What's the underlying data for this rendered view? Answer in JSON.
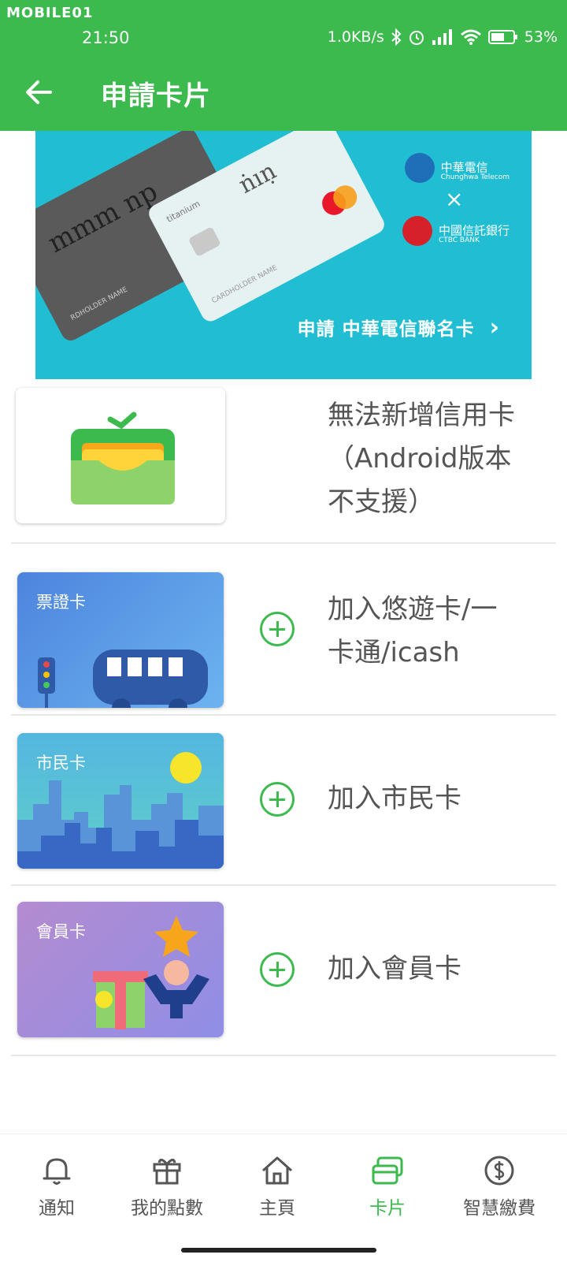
{
  "status_bar": {
    "watermark": "MOBILE01",
    "time": "21:50",
    "net_speed": "1.0KB/s",
    "battery": "53%"
  },
  "app_bar": {
    "title": "申請卡片"
  },
  "banner": {
    "card_dark_text": "mmm np",
    "card_dark_name": "RDHOLDER NAME",
    "card_light_text": "ṅıṇ",
    "card_light_tier": "titanium",
    "card_light_name": "CARDHOLDER NAME",
    "mastercard": "mastercard",
    "partner1": "中華電信",
    "partner1_sub": "Chunghwa Telecom",
    "cross": "×",
    "partner2": "中國信託銀行",
    "partner2_sub": "CTBC BANK",
    "cta": "申請 中華電信聯名卡",
    "cta_chevron": "›"
  },
  "rows": [
    {
      "text_lines": [
        "無法新增信用卡",
        "（Android版本",
        "不支援）"
      ]
    },
    {
      "thumb_label": "票證卡",
      "text_lines": [
        "加入悠遊卡/一",
        "卡通/icash"
      ]
    },
    {
      "thumb_label": "市民卡",
      "text_lines": [
        "加入市民卡"
      ]
    },
    {
      "thumb_label": "會員卡",
      "text_lines": [
        "加入會員卡"
      ]
    }
  ],
  "bottom_nav": [
    {
      "label": "通知",
      "icon": "bell-icon"
    },
    {
      "label": "我的點數",
      "icon": "gift-icon"
    },
    {
      "label": "主頁",
      "icon": "home-icon"
    },
    {
      "label": "卡片",
      "icon": "cards-icon",
      "active": true
    },
    {
      "label": "智慧繳費",
      "icon": "dollar-icon"
    }
  ],
  "colors": {
    "brand_green": "#3dba4e",
    "banner_teal": "#21bed3",
    "text_gray": "#555555"
  }
}
